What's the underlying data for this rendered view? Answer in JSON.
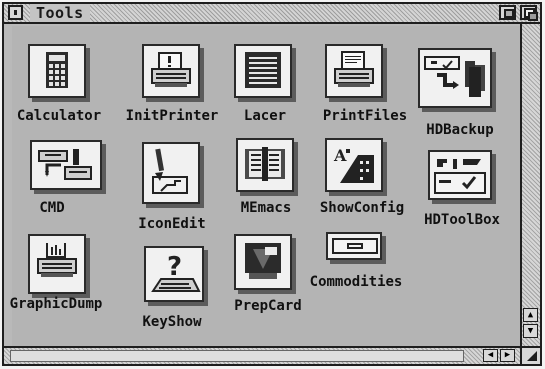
{
  "window": {
    "title": "Tools"
  },
  "icons": [
    {
      "name": "calculator",
      "label": "Calculator",
      "icon": "calculator-icon"
    },
    {
      "name": "initprinter",
      "label": "InitPrinter",
      "icon": "printer-icon"
    },
    {
      "name": "lacer",
      "label": "Lacer",
      "icon": "monitor-lines-icon"
    },
    {
      "name": "printfiles",
      "label": "PrintFiles",
      "icon": "printer-paper-icon"
    },
    {
      "name": "hdbackup",
      "label": "HDBackup",
      "icon": "disk-backup-icon"
    },
    {
      "name": "cmd",
      "label": "CMD",
      "icon": "redirect-printer-icon"
    },
    {
      "name": "iconedit",
      "label": "IconEdit",
      "icon": "pencil-drawing-icon"
    },
    {
      "name": "memacs",
      "label": "MEmacs",
      "icon": "book-editor-icon"
    },
    {
      "name": "showconfig",
      "label": "ShowConfig",
      "icon": "chip-config-icon"
    },
    {
      "name": "hdtoolbox",
      "label": "HDToolBox",
      "icon": "drive-tools-icon"
    },
    {
      "name": "graphicdump",
      "label": "GraphicDump",
      "icon": "graphic-print-icon"
    },
    {
      "name": "keyshow",
      "label": "KeyShow",
      "icon": "keyboard-question-icon"
    },
    {
      "name": "prepcard",
      "label": "PrepCard",
      "icon": "card-icon"
    },
    {
      "name": "commodities",
      "label": "Commodities",
      "icon": "drawer-icon"
    }
  ],
  "colors": {
    "window_bg": "#b4b4b4",
    "tile_bg": "#f1f1f1",
    "border": "#1e1e1e"
  }
}
